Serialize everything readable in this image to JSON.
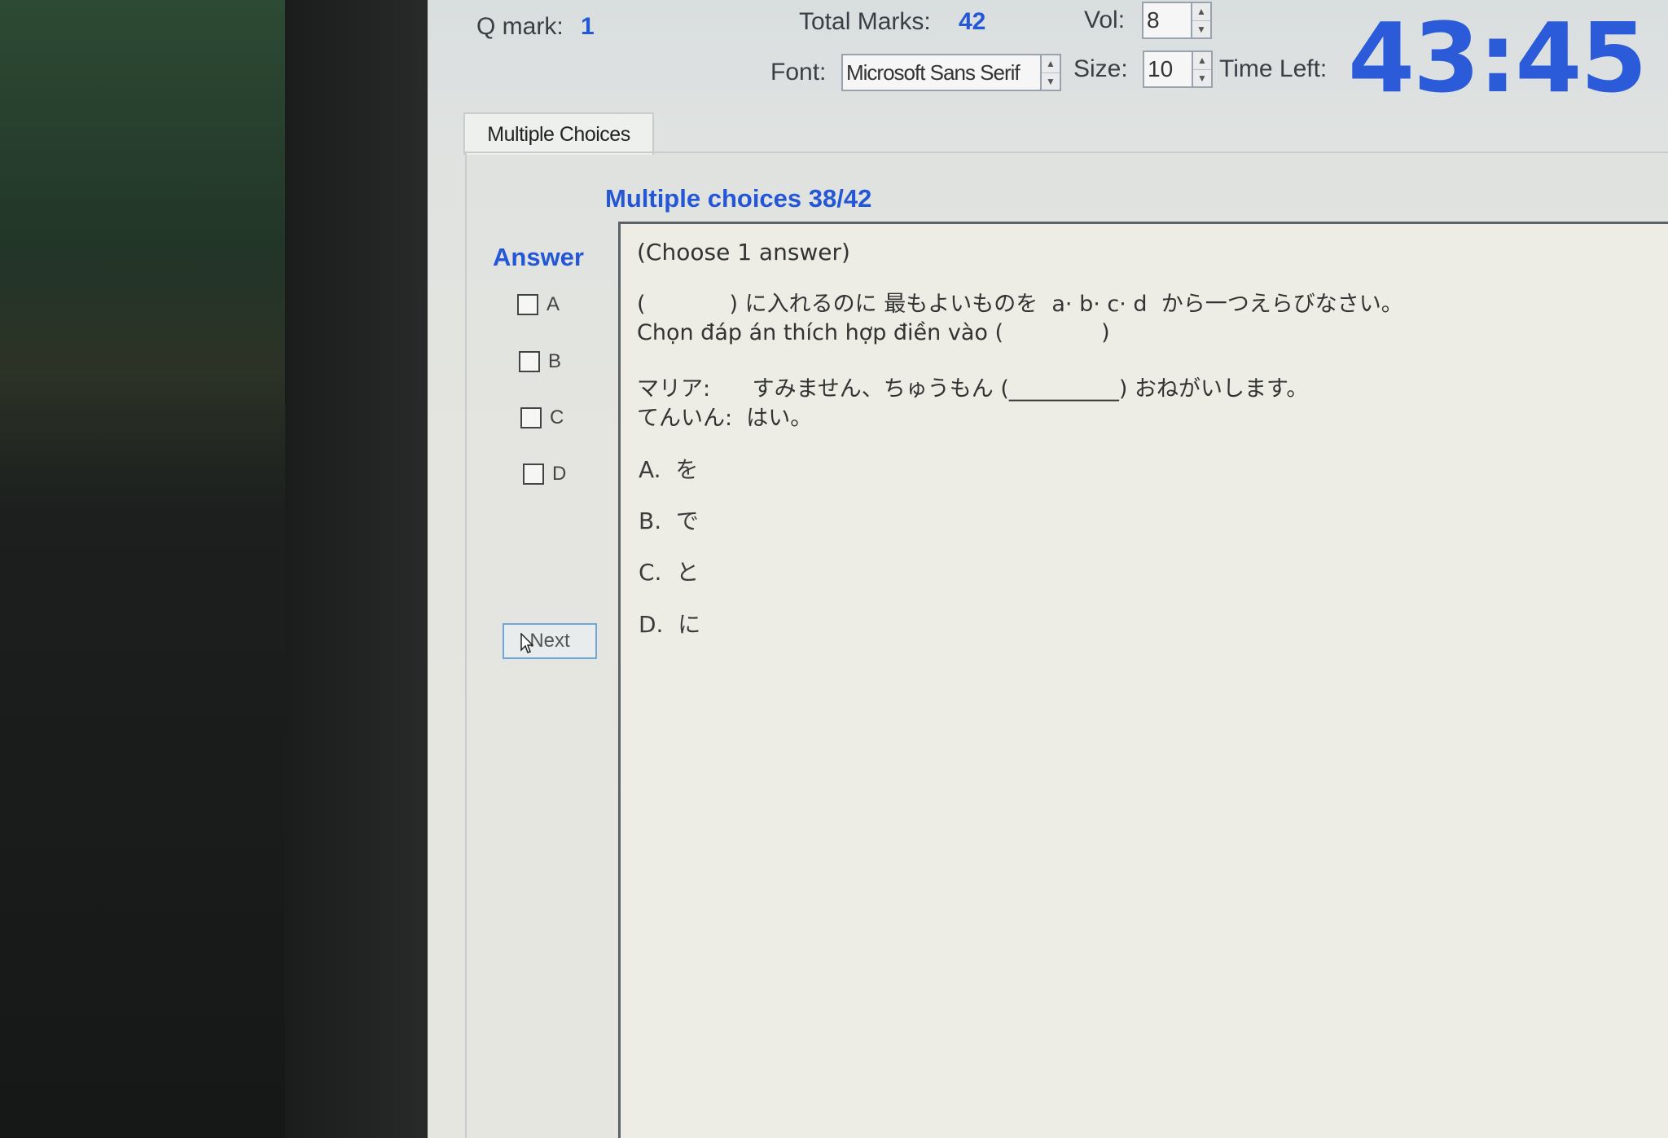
{
  "header": {
    "q_mark_label": "Q mark:",
    "q_mark_value": "1",
    "total_marks_label": "Total Marks:",
    "total_marks_value": "42",
    "vol_label": "Vol:",
    "vol_value": "8",
    "font_label": "Font:",
    "font_value": "Microsoft Sans Serif",
    "size_label": "Size:",
    "size_value": "10",
    "time_left_label": "Time Left:",
    "time_left_value": "43:45"
  },
  "tabs": [
    {
      "label": "Multiple Choices"
    }
  ],
  "section": {
    "title": "Multiple choices 38/42",
    "answer_label": "Answer"
  },
  "answer_choices": [
    {
      "letter": "A",
      "checked": false
    },
    {
      "letter": "B",
      "checked": false
    },
    {
      "letter": "C",
      "checked": false
    },
    {
      "letter": "D",
      "checked": false
    }
  ],
  "next_label": "Next",
  "question": {
    "instruction": "(Choose 1 answer)",
    "line1": "(            ) に入れるのに 最もよいものを  a· b· c· d  から一つえらびなさい。",
    "line2": "Chọn đáp án thích hợp điền vào (              )",
    "line3": "マリア:      すみません、ちゅうもん (__________) おねがいします。",
    "line4": "てんいん:  はい。"
  },
  "options": [
    {
      "text": "A.  を"
    },
    {
      "text": "B.  で"
    },
    {
      "text": "C.  と"
    },
    {
      "text": "D.  に"
    }
  ],
  "colors": {
    "accent": "#2457d6",
    "timer": "#2c5bd9"
  }
}
